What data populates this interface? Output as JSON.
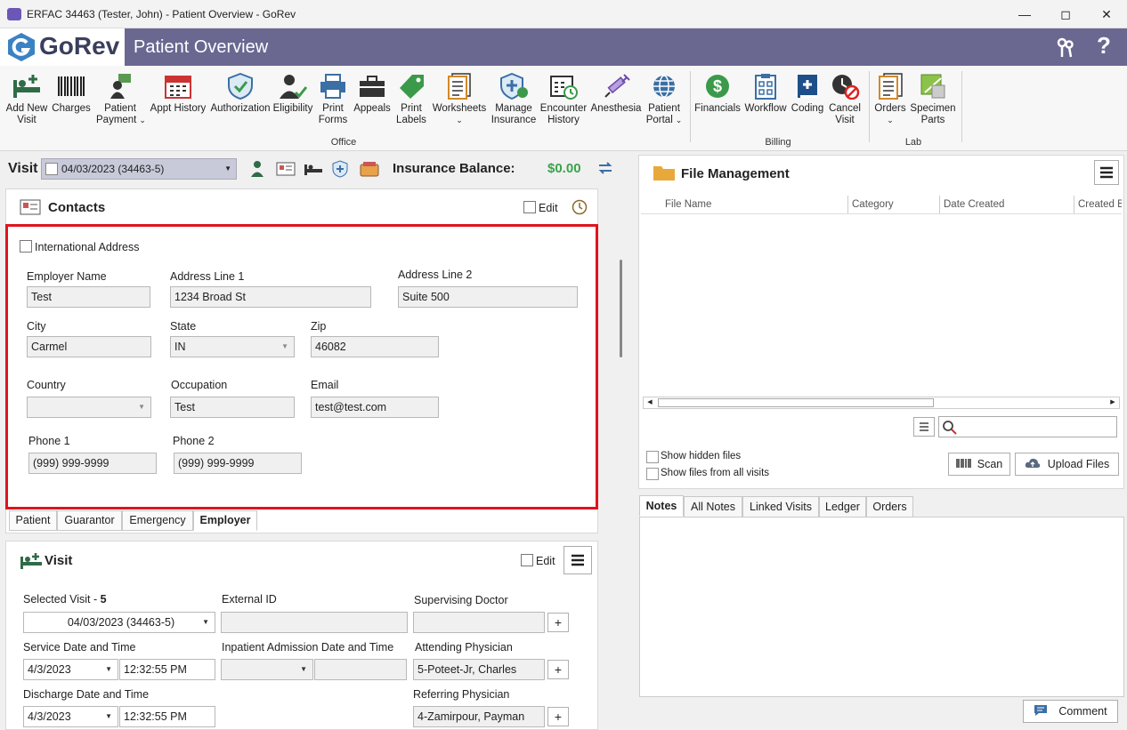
{
  "window": {
    "title": "ERFAC 34463 (Tester, John) - Patient Overview - GoRev",
    "app_icon": "GoRev"
  },
  "header": {
    "logo_text": "GoRev",
    "title": "Patient Overview",
    "help": "?"
  },
  "ribbon": {
    "office": [
      {
        "label1": "Add New",
        "label2": "Visit",
        "icon": "bed-plus-icon"
      },
      {
        "label1": "Charges",
        "label2": "",
        "icon": "barcode-icon"
      },
      {
        "label1": "Patient",
        "label2": "Payment",
        "icon": "payment-icon"
      },
      {
        "label1": "Appt History",
        "label2": "",
        "icon": "calendar-icon"
      },
      {
        "label1": "Authorization",
        "label2": "",
        "icon": "shield-check-icon"
      },
      {
        "label1": "Eligibility",
        "label2": "",
        "icon": "person-check-icon"
      },
      {
        "label1": "Print",
        "label2": "Forms",
        "icon": "printer-icon"
      },
      {
        "label1": "Appeals",
        "label2": "",
        "icon": "briefcase-icon"
      },
      {
        "label1": "Print",
        "label2": "Labels",
        "icon": "tag-icon"
      },
      {
        "label1": "Worksheets",
        "label2": "",
        "icon": "worksheet-icon"
      },
      {
        "label1": "Manage",
        "label2": "Insurance",
        "icon": "insurance-icon"
      },
      {
        "label1": "Encounter",
        "label2": "History",
        "icon": "encounter-icon"
      },
      {
        "label1": "Anesthesia",
        "label2": "",
        "icon": "syringe-icon"
      },
      {
        "label1": "Patient",
        "label2": "Portal",
        "icon": "globe-icon"
      }
    ],
    "billing": [
      {
        "label1": "Financials",
        "label2": "",
        "icon": "dollar-icon"
      },
      {
        "label1": "Workflow",
        "label2": "",
        "icon": "workflow-icon"
      },
      {
        "label1": "Coding",
        "label2": "",
        "icon": "book-icon"
      },
      {
        "label1": "Cancel",
        "label2": "Visit",
        "icon": "cancel-clock-icon"
      }
    ],
    "lab": [
      {
        "label1": "Orders",
        "label2": "",
        "icon": "orders-icon"
      },
      {
        "label1": "Specimen",
        "label2": "Parts",
        "icon": "specimen-icon"
      }
    ],
    "groups": {
      "office": "Office",
      "billing": "Billing",
      "lab": "Lab"
    }
  },
  "visitbar": {
    "label": "Visit",
    "selected": "04/03/2023 (34463-5)",
    "balance_label": "Insurance Balance:",
    "balance_value": "$0.00"
  },
  "contacts": {
    "title": "Contacts",
    "edit_label": "Edit",
    "intl_label": "International Address",
    "employer_name_label": "Employer Name",
    "employer_name": "Test",
    "addr1_label": "Address Line 1",
    "addr1": "1234 Broad St",
    "addr2_label": "Address Line 2",
    "addr2": "Suite 500",
    "city_label": "City",
    "city": "Carmel",
    "state_label": "State",
    "state": "IN",
    "zip_label": "Zip",
    "zip": "46082",
    "country_label": "Country",
    "country": "",
    "occupation_label": "Occupation",
    "occupation": "Test",
    "email_label": "Email",
    "email": "test@test.com",
    "phone1_label": "Phone 1",
    "phone1": "(999) 999-9999",
    "phone2_label": "Phone 2",
    "phone2": "(999) 999-9999",
    "tabs": [
      "Patient",
      "Guarantor",
      "Emergency",
      "Employer"
    ]
  },
  "visit": {
    "title": "Visit",
    "edit_label": "Edit",
    "selected_visit_label": "Selected Visit -",
    "selected_visit_num": "5",
    "selected_visit": "04/03/2023 (34463-5)",
    "external_id_label": "External ID",
    "supervising_label": "Supervising Doctor",
    "service_label": "Service Date and Time",
    "service_date": "4/3/2023",
    "service_time": "12:32:55 PM",
    "inpatient_label": "Inpatient Admission Date and Time",
    "attending_label": "Attending Physician",
    "attending": "5-Poteet-Jr, Charles",
    "discharge_label": "Discharge Date and Time",
    "discharge_date": "4/3/2023",
    "discharge_time": "12:32:55 PM",
    "referring_label": "Referring Physician",
    "referring": "4-Zamirpour, Payman",
    "plus": "+"
  },
  "files": {
    "title": "File Management",
    "columns": [
      "File Name",
      "Category",
      "Date Created",
      "Created B"
    ],
    "show_hidden": "Show hidden files",
    "show_all": "Show files from all visits",
    "scan": "Scan",
    "upload": "Upload Files"
  },
  "notes": {
    "tabs": [
      "Notes",
      "All Notes",
      "Linked Visits",
      "Ledger",
      "Orders"
    ],
    "comment": "Comment"
  },
  "colors": {
    "header": "#6a6891",
    "accent_red": "#e0141e",
    "balance_green": "#3aa34a"
  }
}
